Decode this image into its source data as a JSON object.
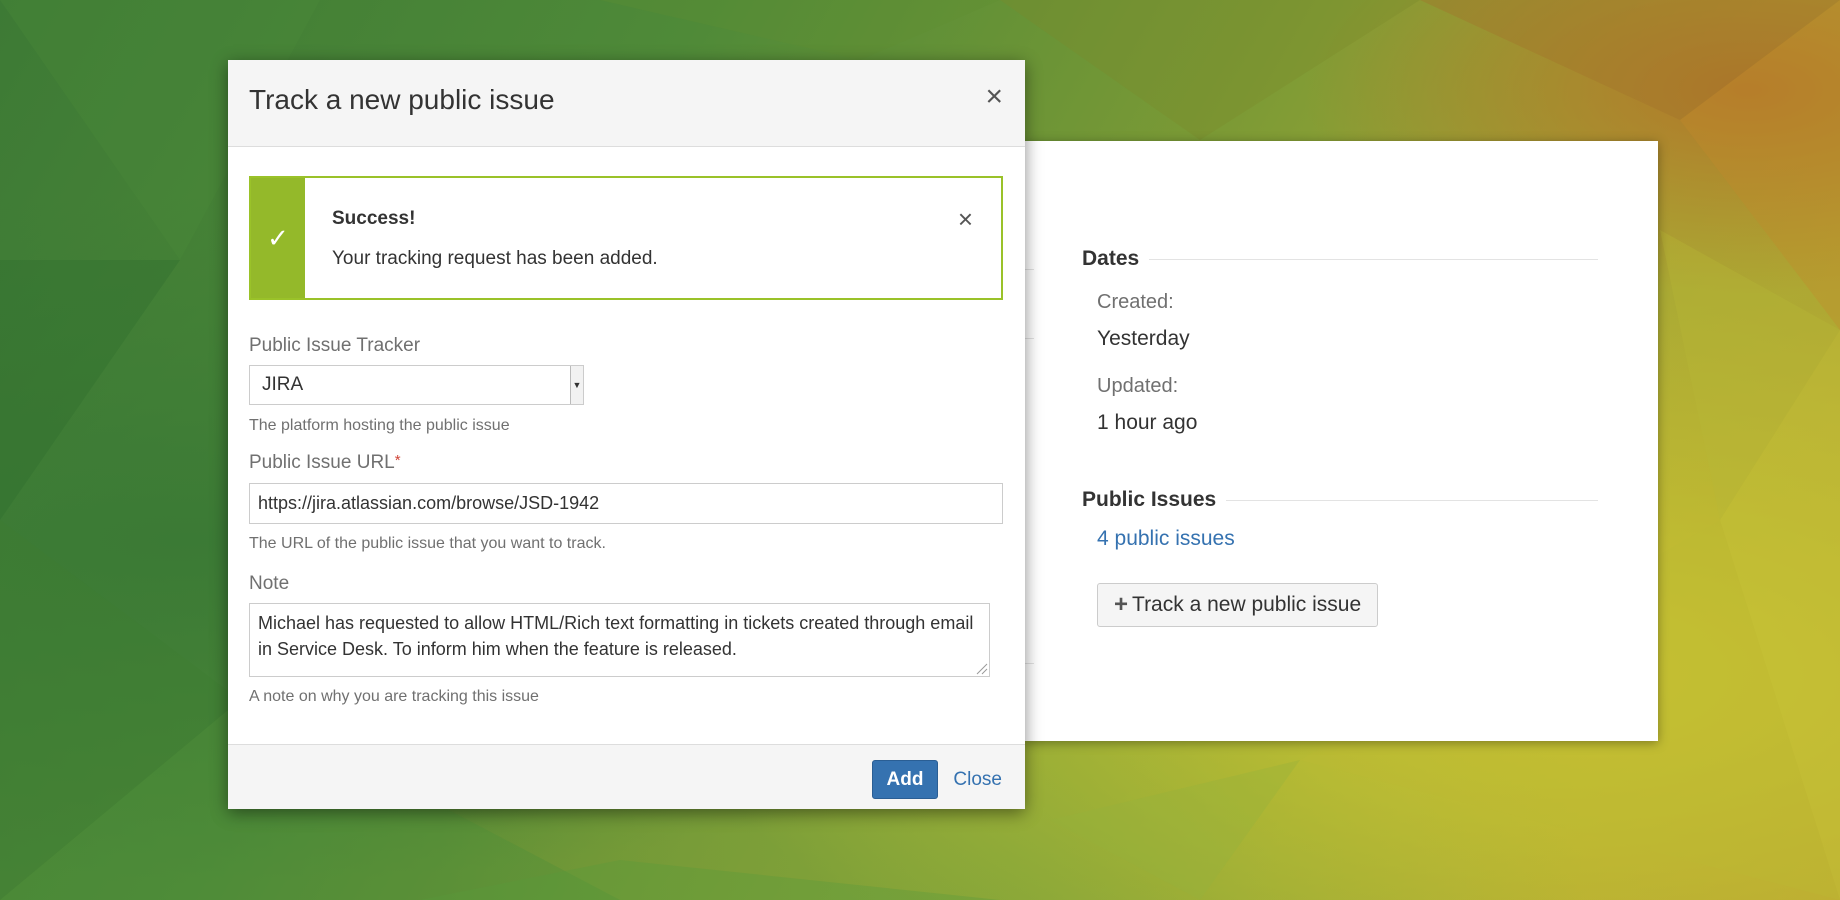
{
  "colors": {
    "primary": "#3572b0",
    "success_border": "#9ac229",
    "success_bar": "#94b92a",
    "required": "#d04437"
  },
  "background_panel": {
    "dates_heading": "Dates",
    "created_label": "Created:",
    "created_value": "Yesterday",
    "updated_label": "Updated:",
    "updated_value": "1 hour ago",
    "public_issues_heading": "Public Issues",
    "public_issues_link": "4 public issues",
    "track_button_label": "Track a new public issue",
    "track_button_icon": "plus-icon"
  },
  "dialog": {
    "title": "Track a new public issue",
    "close_icon": "×",
    "alert": {
      "icon": "✓",
      "title": "Success!",
      "message": "Your tracking request has been added.",
      "close_icon": "×"
    },
    "tracker": {
      "label": "Public Issue Tracker",
      "selected": "JIRA",
      "help": "The platform hosting the public issue"
    },
    "url": {
      "label": "Public Issue URL",
      "required_mark": "*",
      "value": "https://jira.atlassian.com/browse/JSD-1942",
      "help": "The URL of the public issue that you want to track."
    },
    "note": {
      "label": "Note",
      "value": "Michael has requested to allow HTML/Rich text formatting in tickets created through email in Service Desk. To inform him when the feature is released.",
      "help": "A note on why you are tracking this issue"
    },
    "footer": {
      "add_label": "Add",
      "close_label": "Close"
    }
  }
}
